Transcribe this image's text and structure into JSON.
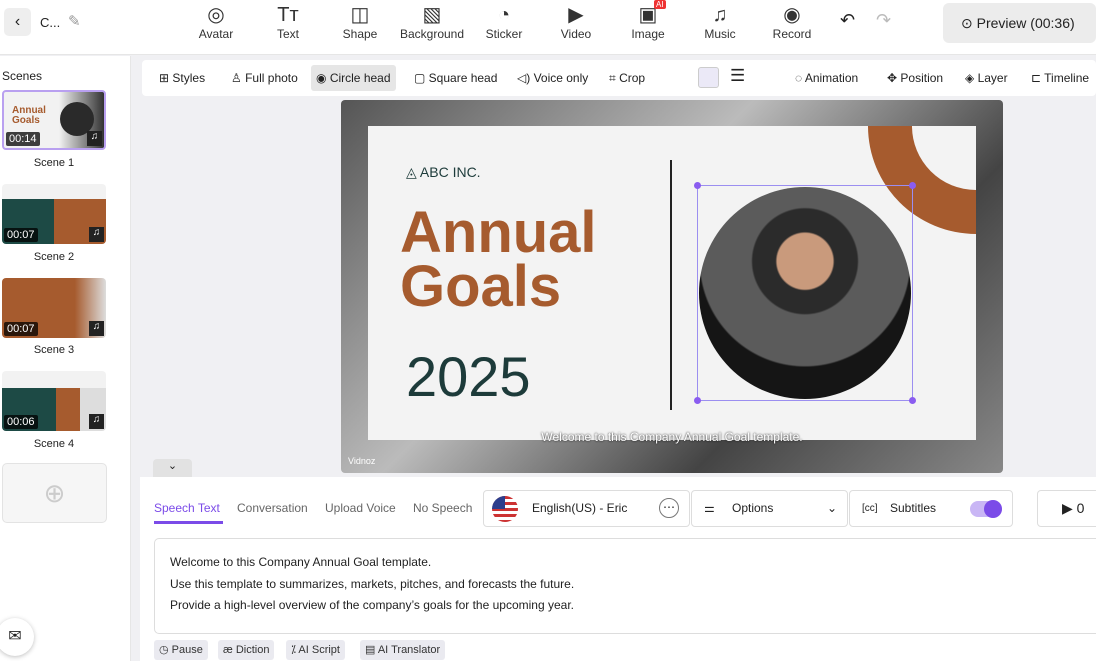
{
  "header": {
    "project_title": "C...",
    "tools": [
      {
        "label": "Avatar",
        "icon": "avatar-icon"
      },
      {
        "label": "Text",
        "icon": "text-icon"
      },
      {
        "label": "Shape",
        "icon": "shape-icon"
      },
      {
        "label": "Background",
        "icon": "background-icon"
      },
      {
        "label": "Sticker",
        "icon": "sticker-icon"
      },
      {
        "label": "Video",
        "icon": "video-icon"
      },
      {
        "label": "Image",
        "icon": "image-icon",
        "badge": "AI"
      },
      {
        "label": "Music",
        "icon": "music-icon"
      },
      {
        "label": "Record",
        "icon": "record-icon"
      }
    ],
    "preview_label": "Preview (00:36)"
  },
  "sidebar": {
    "title": "Scenes",
    "scenes": [
      {
        "label": "Scene 1",
        "duration": "00:14",
        "selected": true
      },
      {
        "label": "Scene 2",
        "duration": "00:07"
      },
      {
        "label": "Scene 3",
        "duration": "00:07"
      },
      {
        "label": "Scene 4",
        "duration": "00:06"
      }
    ]
  },
  "toolbar": {
    "items": [
      "Styles",
      "Full photo",
      "Circle head",
      "Square head",
      "Voice only",
      "Crop"
    ],
    "active": "Circle head",
    "right_items": [
      "Animation",
      "Position",
      "Layer",
      "Timeline"
    ],
    "swatch_color": "#ebe9f7"
  },
  "slide": {
    "company": "ABC INC.",
    "title_line1": "Annual",
    "title_line2": "Goals",
    "year": "2025",
    "subtitle": "Welcome to this Company Annual Goal template.",
    "watermark": "Vidnoz",
    "accent": "#a65b2e"
  },
  "panel": {
    "tabs": [
      "Speech Text",
      "Conversation",
      "Upload Voice",
      "No Speech"
    ],
    "active_tab": "Speech Text",
    "voice": "English(US) - Eric",
    "options_label": "Options",
    "subtitles_label": "Subtitles",
    "subtitles_on": true,
    "play_label": "0",
    "script_lines": [
      "Welcome to this Company Annual Goal template.",
      "Use this template to summarizes, markets, pitches, and forecasts the future.",
      "Provide a high-level overview of the company’s goals for the upcoming year."
    ],
    "chips": [
      "Pause",
      "Diction",
      "AI Script",
      "AI Translator"
    ]
  }
}
